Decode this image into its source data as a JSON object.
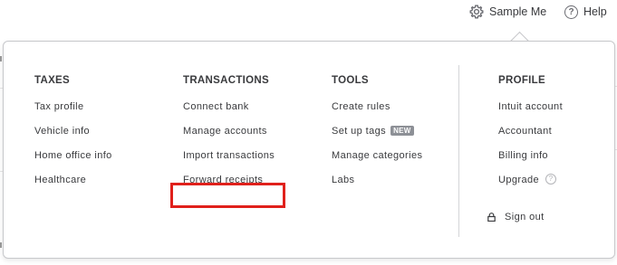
{
  "header": {
    "user_label": "Sample Me",
    "user_icon": "gear-icon",
    "help_label": "Help",
    "help_icon": "help-circle-icon"
  },
  "menu": {
    "columns": [
      {
        "heading": "TAXES",
        "items": [
          "Tax profile",
          "Vehicle info",
          "Home office info",
          "Healthcare"
        ]
      },
      {
        "heading": "TRANSACTIONS",
        "items": [
          "Connect bank",
          "Manage accounts",
          "Import transactions",
          "Forward receipts"
        ]
      },
      {
        "heading": "TOOLS",
        "items": [
          "Create rules",
          "Set up tags",
          "Manage categories",
          "Labs"
        ],
        "badge": "NEW"
      },
      {
        "heading": "PROFILE",
        "items": [
          "Intuit account",
          "Accountant",
          "Billing info",
          "Upgrade"
        ],
        "upgrade_help_icon": "question-circle-icon"
      }
    ],
    "sign_out_label": "Sign out",
    "sign_out_icon": "lock-icon"
  },
  "colors": {
    "highlight": "#e0201b",
    "text": "#393a3d",
    "badge_bg": "#8d9096",
    "border": "#c7c8cb"
  }
}
